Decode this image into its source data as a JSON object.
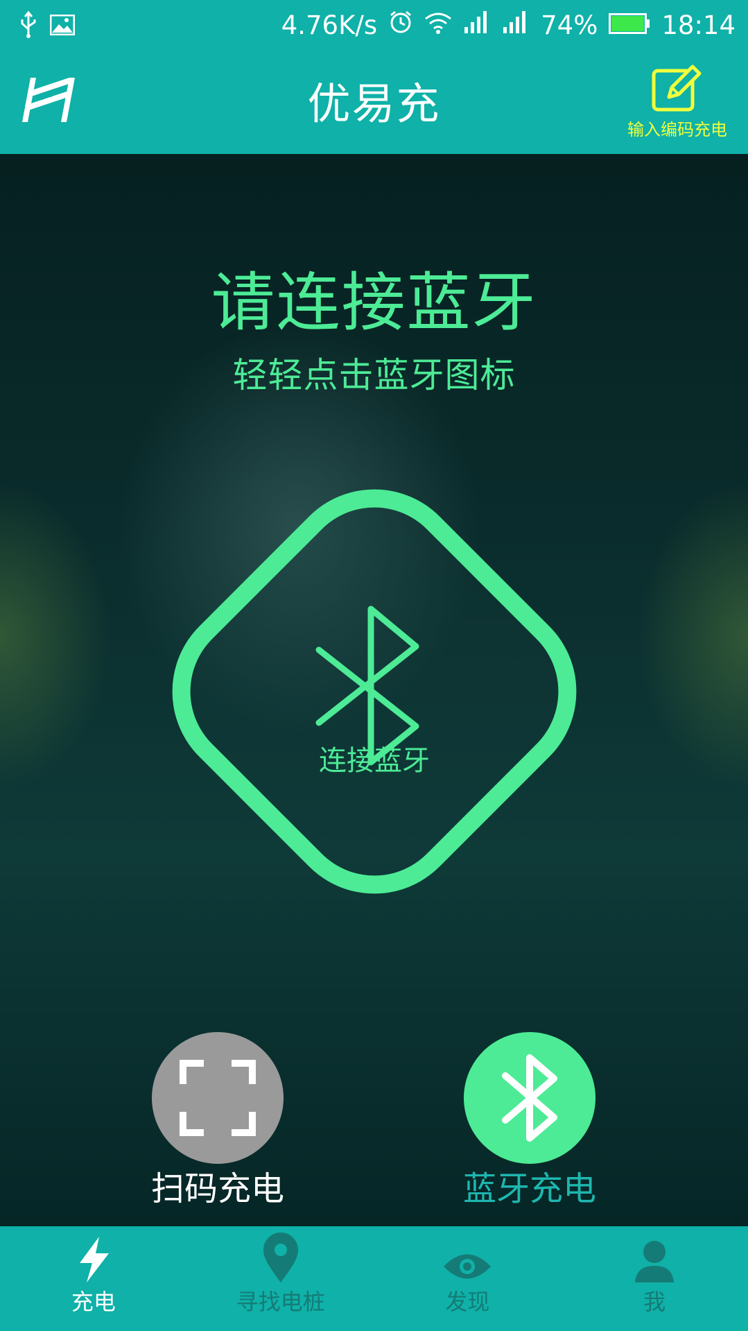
{
  "status_bar": {
    "net_speed": "4.76K/s",
    "battery_percent": "74%",
    "time": "18:14"
  },
  "app_bar": {
    "title": "优易充",
    "edit_label": "输入编码充电"
  },
  "main": {
    "headline": "请连接蓝牙",
    "subline": "轻轻点击蓝牙图标",
    "connect_label": "连接蓝牙"
  },
  "modes": [
    {
      "label": "扫码充电"
    },
    {
      "label": "蓝牙充电"
    }
  ],
  "bottom_nav": {
    "items": [
      {
        "label": "充电",
        "icon": "lightning-icon"
      },
      {
        "label": "寻找电桩",
        "icon": "map-pin-icon"
      },
      {
        "label": "发现",
        "icon": "eye-icon"
      },
      {
        "label": "我",
        "icon": "person-icon"
      }
    ]
  },
  "colors": {
    "primary": "#0fb1a8",
    "accent_green": "#4deb96",
    "edit_yellow": "#f0ff3c",
    "scan_gray": "#9a9a9a",
    "label_teal": "#1eb6b0",
    "nav_inactive": "#157b76"
  }
}
